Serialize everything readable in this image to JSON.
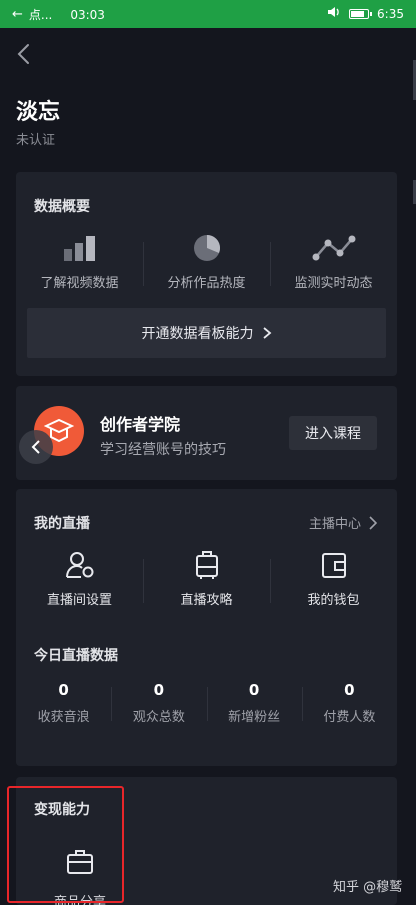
{
  "status_bar": {
    "back_text": "点...",
    "time": "03:03",
    "clock_right": "6:35"
  },
  "header": {
    "title": "淡忘",
    "subtitle": "未认证"
  },
  "data_overview": {
    "title": "数据概要",
    "items": [
      {
        "label": "了解视频数据",
        "icon": "bar-chart-icon"
      },
      {
        "label": "分析作品热度",
        "icon": "pie-chart-icon"
      },
      {
        "label": "监测实时动态",
        "icon": "line-trend-icon"
      }
    ],
    "open_button": "开通数据看板能力"
  },
  "academy": {
    "title": "创作者学院",
    "description": "学习经营账号的技巧",
    "button": "进入课程"
  },
  "live": {
    "title": "我的直播",
    "host_center": "主播中心",
    "items": [
      {
        "label": "直播间设置",
        "icon": "user-settings-icon"
      },
      {
        "label": "直播攻略",
        "icon": "luggage-icon"
      },
      {
        "label": "我的钱包",
        "icon": "wallet-icon"
      }
    ],
    "today_title": "今日直播数据",
    "stats": [
      {
        "value": "0",
        "label": "收获音浪"
      },
      {
        "value": "0",
        "label": "观众总数"
      },
      {
        "value": "0",
        "label": "新增粉丝"
      },
      {
        "value": "0",
        "label": "付费人数"
      }
    ]
  },
  "monetization": {
    "title": "变现能力",
    "items": [
      {
        "label": "商品分享",
        "icon": "briefcase-icon"
      }
    ]
  },
  "watermark": "知乎 @穆鹫",
  "colors": {
    "status_green": "#1fa045",
    "background": "#14161e",
    "card": "#1f222b",
    "accent_orange": "#f05a38",
    "highlight_red": "#e8262a"
  }
}
